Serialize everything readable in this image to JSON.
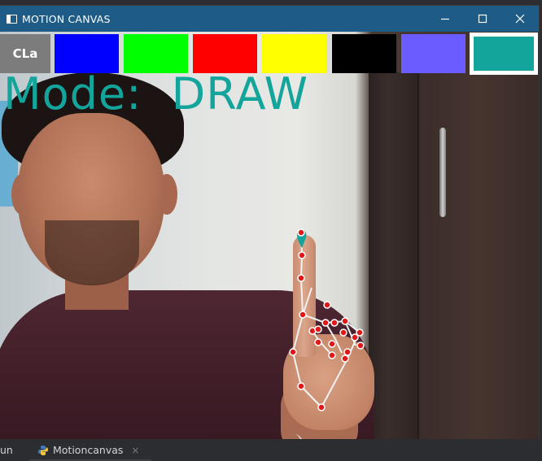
{
  "window": {
    "title": "MOTION CANVAS",
    "controls": [
      "minimize",
      "maximize",
      "close"
    ]
  },
  "palette": {
    "clear_label": "CLa",
    "swatches": [
      {
        "name": "blue",
        "color": "#0000ff"
      },
      {
        "name": "green",
        "color": "#00ff00"
      },
      {
        "name": "red",
        "color": "#ff0000"
      },
      {
        "name": "yellow",
        "color": "#ffff00"
      },
      {
        "name": "black",
        "color": "#000000"
      },
      {
        "name": "violet",
        "color": "#6a5cff"
      },
      {
        "name": "teal",
        "color": "#13a59c",
        "selected": true
      }
    ]
  },
  "overlay": {
    "mode_label": "Mode:",
    "mode_value": "DRAW",
    "accent_color": "#13a59c",
    "landmark_color": "#e01818",
    "connection_color": "#f2f2f2"
  },
  "ide": {
    "run_label": "un",
    "tab_label": "Motioncanvas",
    "tab_close": "×"
  }
}
